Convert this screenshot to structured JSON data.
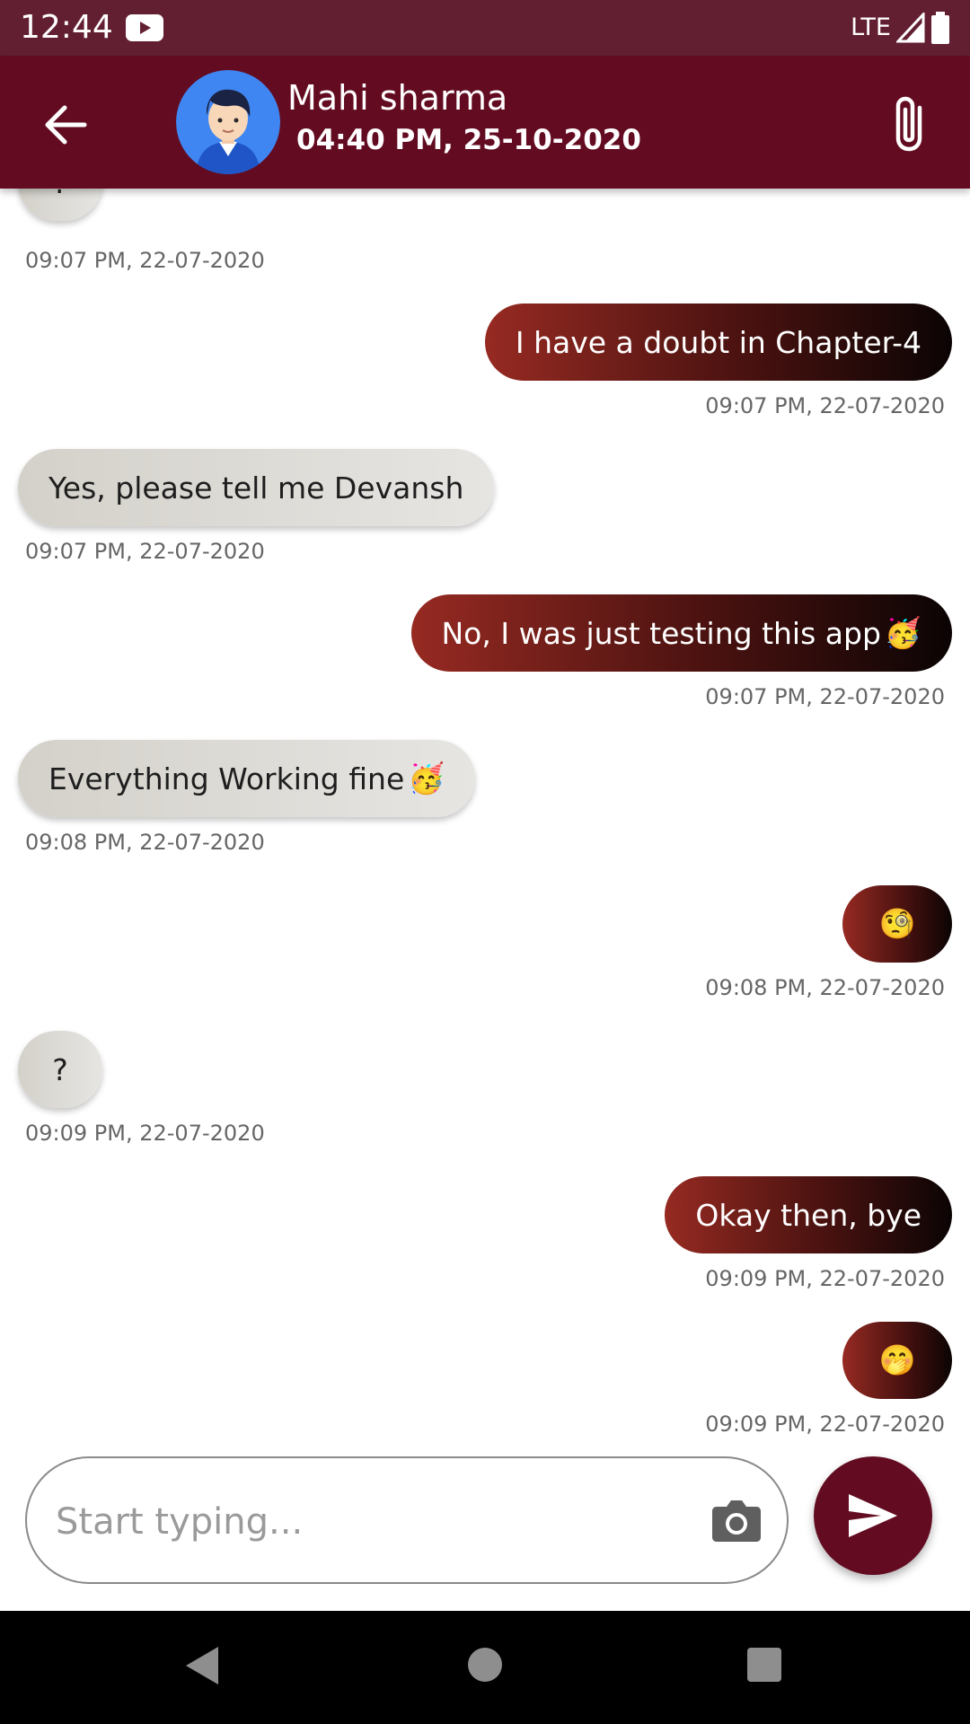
{
  "status_bar": {
    "time": "12:44",
    "network": "LTE",
    "icons": [
      "youtube-icon",
      "signal-icon",
      "battery-icon"
    ]
  },
  "header": {
    "contact_name": "Mahi sharma",
    "last_seen": "04:40 PM, 25-10-2020",
    "icons": [
      "back-arrow-icon",
      "avatar",
      "paperclip-icon"
    ]
  },
  "messages": [
    {
      "type": "received",
      "text": "?",
      "time": "09:07 PM, 22-07-2020"
    },
    {
      "type": "sent",
      "text": "I have a doubt in Chapter-4",
      "time": "09:07 PM, 22-07-2020"
    },
    {
      "type": "received",
      "text": "Yes, please tell me Devansh",
      "time": "09:07 PM, 22-07-2020"
    },
    {
      "type": "sent",
      "text": "No, I was just testing this app",
      "emoji": "🥳",
      "time": "09:07 PM, 22-07-2020"
    },
    {
      "type": "received",
      "text": "Everything Working fine",
      "emoji": "🥳",
      "time": "09:08 PM, 22-07-2020"
    },
    {
      "type": "sent",
      "text": "",
      "emoji": "🧐",
      "time": "09:08 PM, 22-07-2020"
    },
    {
      "type": "received",
      "text": "?",
      "time": "09:09 PM, 22-07-2020"
    },
    {
      "type": "sent",
      "text": "Okay then, bye",
      "time": "09:09 PM, 22-07-2020"
    },
    {
      "type": "sent",
      "text": "",
      "emoji": "🤭",
      "time": "09:09 PM, 22-07-2020"
    }
  ],
  "composer": {
    "placeholder": "Start typing...",
    "value": "",
    "icons": [
      "camera-icon",
      "send-icon"
    ]
  },
  "colors": {
    "status_bar": "#631f32",
    "app_bar": "#630c21",
    "send_button": "#630c21",
    "sent_bubble_start": "#962a22",
    "sent_bubble_end": "#0b0404",
    "received_bubble": "#dcdad5"
  }
}
